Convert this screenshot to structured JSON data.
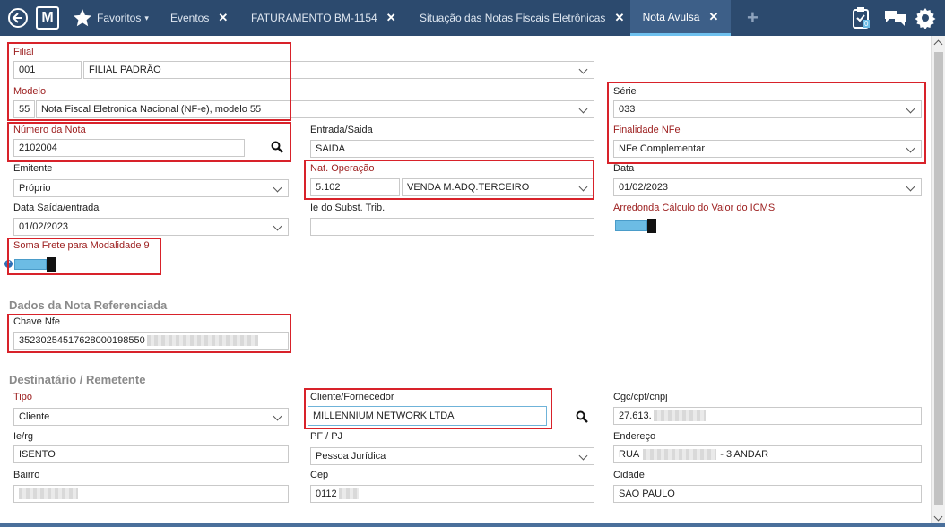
{
  "topbar": {
    "logo": "M",
    "favorites_label": "Favoritos",
    "tabs": [
      {
        "label": "Eventos",
        "close": "✕"
      },
      {
        "label": "FATURAMENTO BM-1154",
        "close": "✕"
      },
      {
        "label": "Situação das Notas Fiscais Eletrônicas",
        "close": "✕"
      },
      {
        "label": "Nota Avulsa",
        "close": "✕"
      }
    ],
    "add_tab": "+",
    "clipboard_badge": "0",
    "icons": [
      "back-icon",
      "star-icon",
      "clipboard-icon",
      "chat-icon",
      "gear-icon"
    ]
  },
  "form": {
    "filial": {
      "label": "Filial",
      "code": "001",
      "name": "FILIAL PADRÃO"
    },
    "modelo": {
      "label": "Modelo",
      "code": "55",
      "name": "Nota Fiscal Eletronica Nacional (NF-e), modelo 55"
    },
    "serie": {
      "label": "Série",
      "value": "033"
    },
    "numero_nota": {
      "label": "Número da Nota",
      "value": "2102004"
    },
    "entrada_saida": {
      "label": "Entrada/Saida",
      "value": "SAIDA"
    },
    "finalidade": {
      "label": "Finalidade NFe",
      "value": "NFe Complementar"
    },
    "emitente": {
      "label": "Emitente",
      "value": "Próprio"
    },
    "nat_operacao": {
      "label": "Nat. Operação",
      "code": "5.102",
      "desc": "VENDA M.ADQ.TERCEIRO"
    },
    "data": {
      "label": "Data",
      "value": "01/02/2023"
    },
    "data_saida": {
      "label": "Data Saída/entrada",
      "value": "01/02/2023"
    },
    "ie_subst": {
      "label": "Ie do Subst. Trib.",
      "value": ""
    },
    "arredonda": {
      "label": "Arredonda Cálculo do Valor do ICMS"
    },
    "soma_frete": {
      "label": "Soma Frete para Modalidade 9"
    }
  },
  "referenciada": {
    "title": "Dados da Nota Referenciada",
    "chave": {
      "label": "Chave Nfe",
      "value": "35230254517628000198550"
    }
  },
  "destinatario": {
    "title": "Destinatário / Remetente",
    "tipo": {
      "label": "Tipo",
      "value": "Cliente"
    },
    "cliente": {
      "label": "Cliente/Fornecedor",
      "value": "MILLENNIUM NETWORK LTDA"
    },
    "cgc": {
      "label": "Cgc/cpf/cnpj",
      "value": "27.613."
    },
    "ie_rg": {
      "label": "Ie/rg",
      "value": "ISENTO"
    },
    "pf_pj": {
      "label": "PF / PJ",
      "value": "Pessoa Jurídica"
    },
    "endereco": {
      "label": "Endereço",
      "prefix": "RUA",
      "suffix": "- 3 ANDAR"
    },
    "bairro": {
      "label": "Bairro",
      "value": ""
    },
    "cep": {
      "label": "Cep",
      "value": "0112"
    },
    "cidade": {
      "label": "Cidade",
      "value": "SAO PAULO"
    }
  },
  "help_icon": "?",
  "colors": {
    "topbar": "#2c4a6e",
    "active_tab": "#3d5f88",
    "highlight": "#d8222a",
    "required_label": "#9b1c1c",
    "toggle": "#6cbce4"
  }
}
